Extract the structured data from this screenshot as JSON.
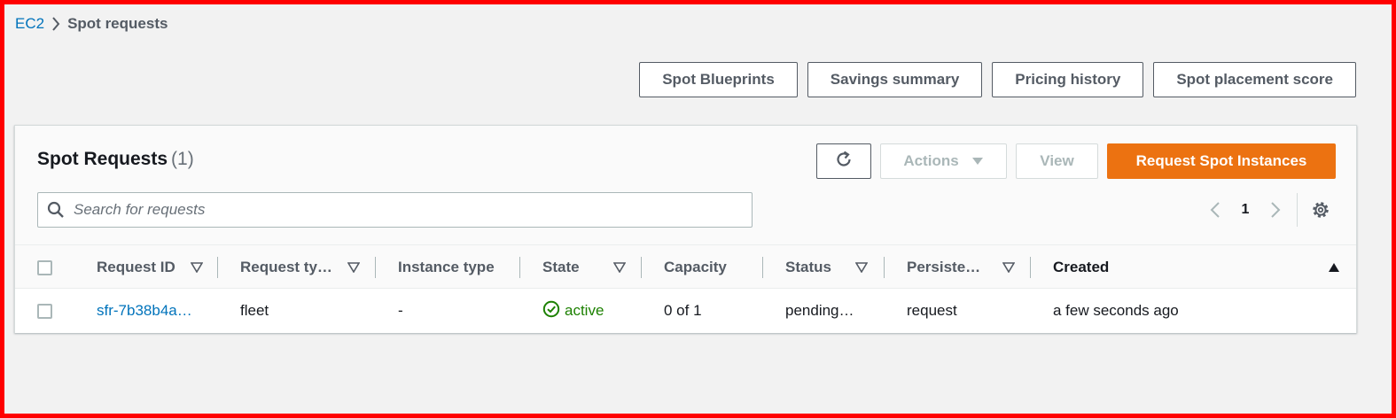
{
  "breadcrumb": {
    "root": "EC2",
    "current": "Spot requests"
  },
  "top_actions": [
    "Spot Blueprints",
    "Savings summary",
    "Pricing history",
    "Spot placement score"
  ],
  "panel": {
    "title": "Spot Requests",
    "count": "(1)",
    "actions_label": "Actions",
    "view_label": "View",
    "request_label": "Request Spot Instances",
    "search_placeholder": "Search for requests",
    "search_value": "",
    "page_number": "1"
  },
  "table": {
    "headers": {
      "request_id": "Request ID",
      "request_type": "Request ty…",
      "instance_type": "Instance type",
      "state": "State",
      "capacity": "Capacity",
      "status": "Status",
      "persistence": "Persiste…",
      "created": "Created"
    },
    "rows": [
      {
        "request_id": "sfr-7b38b4a…",
        "request_type": "fleet",
        "instance_type": "-",
        "state": "active",
        "capacity": "0 of 1",
        "status": "pending…",
        "persistence": "request",
        "created": "a few seconds ago"
      }
    ]
  },
  "colors": {
    "accent_orange": "#ec7211",
    "link_blue": "#0073bb",
    "success_green": "#1d8102",
    "frame_red": "#ff0000"
  },
  "icons": [
    "chevron-right-icon",
    "refresh-icon",
    "caret-down-icon",
    "search-icon",
    "chevron-left-icon",
    "gear-icon",
    "filter-icon",
    "sort-ascending-icon",
    "check-circle-icon"
  ]
}
